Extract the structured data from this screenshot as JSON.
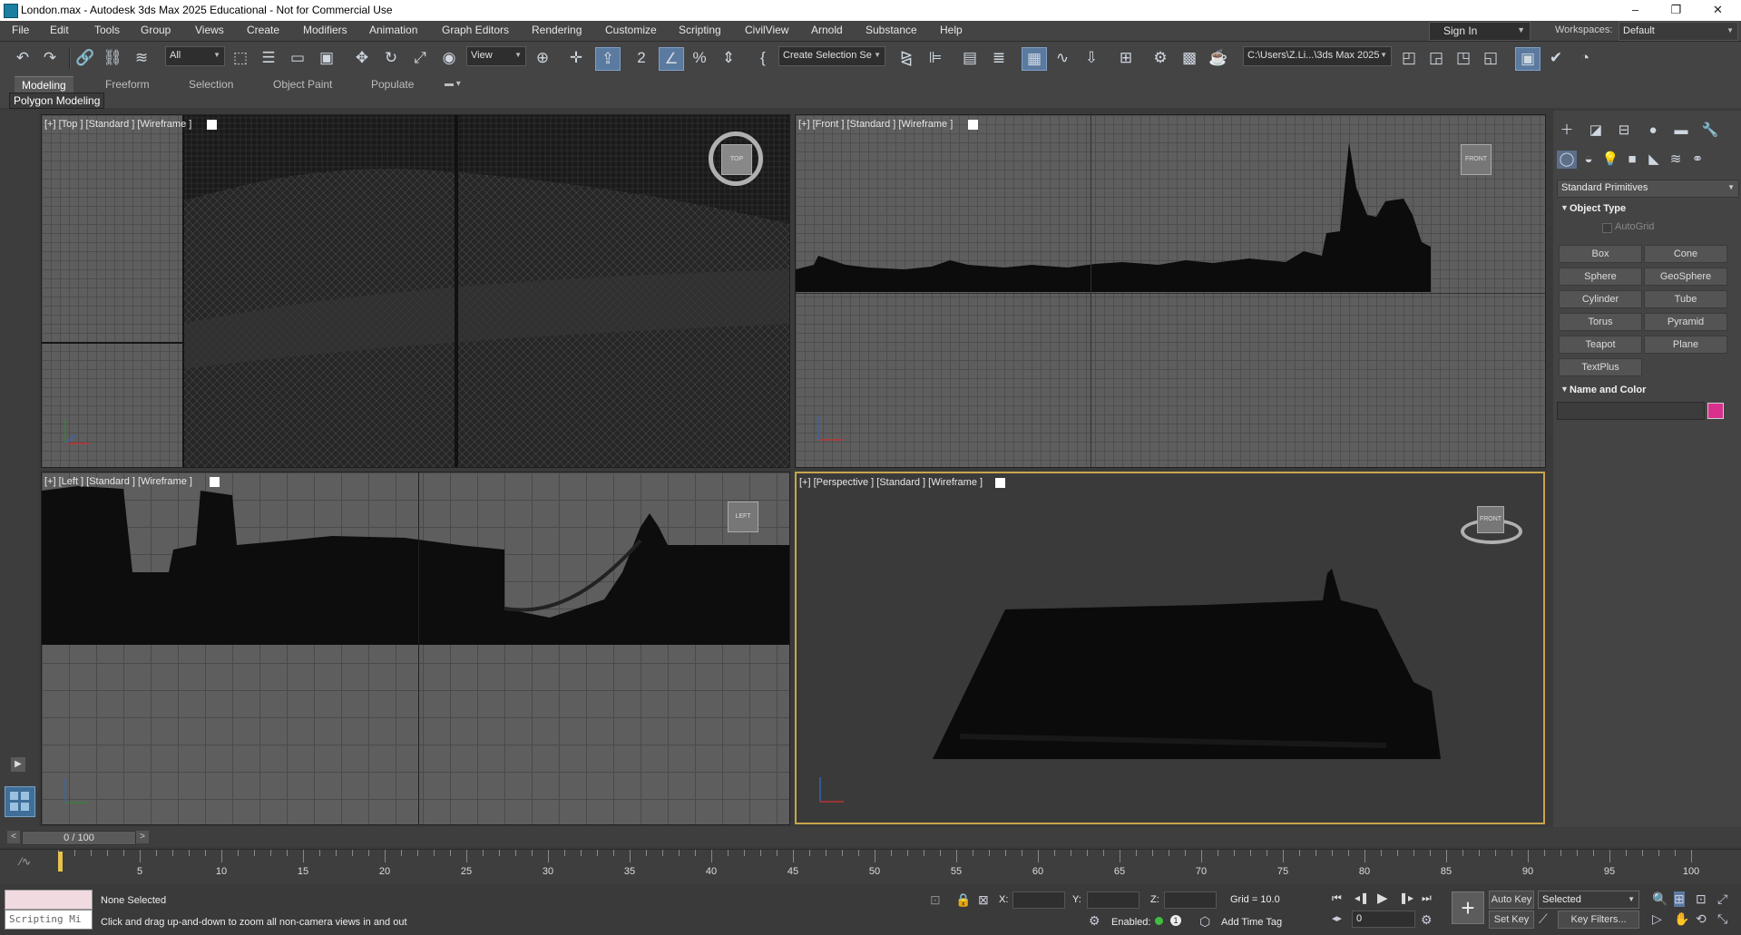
{
  "title_bar": {
    "text": "London.max - Autodesk 3ds Max 2025 Educational - Not for Commercial Use",
    "minimize": "–",
    "maximize": "❐",
    "close": "✕"
  },
  "menu": [
    "File",
    "Edit",
    "Tools",
    "Group",
    "Views",
    "Create",
    "Modifiers",
    "Animation",
    "Graph Editors",
    "Rendering",
    "Customize",
    "Scripting",
    "CivilView",
    "Arnold",
    "Substance",
    "Help"
  ],
  "sign_in": "Sign In",
  "workspaces": {
    "label": "Workspaces:",
    "value": "Default"
  },
  "toolbar": {
    "selection_filter": "All",
    "ref_coord": "View",
    "named_selection": "Create Selection Se",
    "project_path": "C:\\Users\\Z.Li...\\3ds Max 2025"
  },
  "ribbon": {
    "tabs": [
      "Modeling",
      "Freeform",
      "Selection",
      "Object Paint",
      "Populate"
    ],
    "active_tab": "Modeling",
    "sub_label": "Polygon Modeling"
  },
  "viewports": {
    "top": "[+] [Top ] [Standard ] [Wireframe ]",
    "front": "[+] [Front ] [Standard ] [Wireframe ]",
    "left": "[+] [Left ] [Standard ] [Wireframe ]",
    "perspective": "[+] [Perspective ] [Standard ] [Wireframe ]",
    "cube_top": "TOP",
    "cube_front": "FRONT",
    "cube_left": "LEFT"
  },
  "command_panel": {
    "category": "Standard Primitives",
    "object_type": "Object Type",
    "autogrid": "AutoGrid",
    "buttons": [
      "Box",
      "Cone",
      "Sphere",
      "GeoSphere",
      "Cylinder",
      "Tube",
      "Torus",
      "Pyramid",
      "Teapot",
      "Plane",
      "TextPlus"
    ],
    "name_and_color": "Name and Color",
    "swatch_color": "#d8308c"
  },
  "time_slider": {
    "label": "0 / 100"
  },
  "track": {
    "ticks": [
      "5",
      "10",
      "15",
      "20",
      "25",
      "30",
      "35",
      "40",
      "45",
      "50",
      "55",
      "60",
      "65",
      "70",
      "75",
      "80",
      "85",
      "90",
      "95",
      "100"
    ]
  },
  "status": {
    "script_placeholder": "Scripting Mi",
    "selection": "None Selected",
    "prompt": "Click and drag up-and-down to zoom all non-camera views in and out",
    "x_label": "X:",
    "y_label": "Y:",
    "z_label": "Z:",
    "grid": "Grid = 10.0",
    "enabled": "Enabled:",
    "enabled_count": "1",
    "add_time_tag": "Add Time Tag",
    "auto_key": "Auto Key",
    "set_key": "Set Key",
    "key_mode": "Selected",
    "key_filters": "Key Filters...",
    "frame": "0"
  }
}
